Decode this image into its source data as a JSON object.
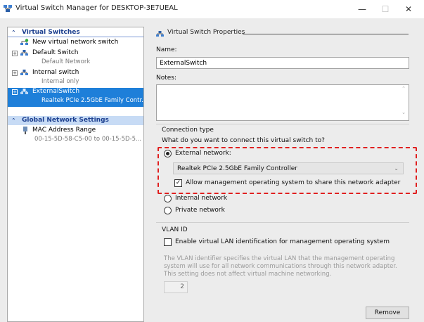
{
  "window": {
    "title": "Virtual Switch Manager for DESKTOP-3E7UEAL",
    "minimize_glyph": "—",
    "maximize_glyph": "☐",
    "close_glyph": "✕"
  },
  "left_panel": {
    "virtual_switches_header": "Virtual Switches",
    "new_switch_label": "New virtual network switch",
    "switches": [
      {
        "name": "Default Switch",
        "subtitle": "Default Network",
        "expander": "+"
      },
      {
        "name": "Internal switch",
        "subtitle": "Internal only",
        "expander": "+"
      },
      {
        "name": "ExternalSwitch",
        "subtitle": "Realtek PCIe 2.5GbE Family Contr...",
        "expander": "+"
      }
    ],
    "global_settings_header": "Global Network Settings",
    "mac_range_label": "MAC Address Range",
    "mac_range_value": "00-15-5D-58-C5-00 to 00-15-5D-5..."
  },
  "properties": {
    "group_title": "Virtual Switch Properties",
    "name_label": "Name:",
    "name_value": "ExternalSwitch",
    "notes_label": "Notes:",
    "notes_value": "",
    "connection_type_label": "Connection type",
    "connection_question": "What do you want to connect this virtual switch to?",
    "external_label": "External network:",
    "external_adapter": "Realtek PCIe 2.5GbE Family Controller",
    "allow_management_label": "Allow management operating system to share this network adapter",
    "allow_management_checked": true,
    "internal_label": "Internal network",
    "private_label": "Private network",
    "selected_connection": "external",
    "vlan_header": "VLAN ID",
    "vlan_enable_label": "Enable virtual LAN identification for management operating system",
    "vlan_enable_checked": false,
    "vlan_help": "The VLAN identifier specifies the virtual LAN that the management operating system will use for all network communications through this network adapter. This setting does not affect virtual machine networking.",
    "vlan_value": "2",
    "remove_button": "Remove"
  },
  "colors": {
    "selection": "#1e7fd9",
    "header_text": "#1c3f8f",
    "highlight_border": "#e02020"
  }
}
